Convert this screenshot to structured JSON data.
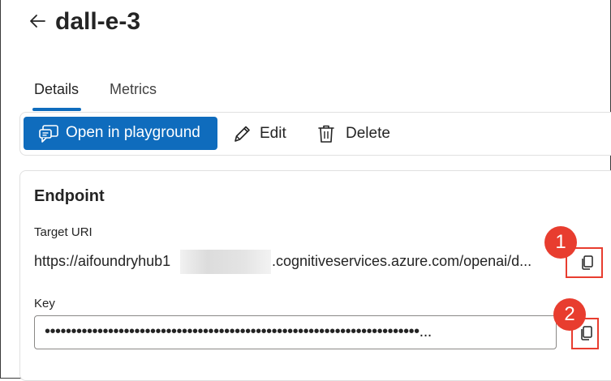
{
  "header": {
    "title": "dall-e-3",
    "back_icon": "arrow-left-icon"
  },
  "tabs": [
    {
      "label": "Details",
      "active": true
    },
    {
      "label": "Metrics",
      "active": false
    }
  ],
  "toolbar": {
    "open_playground_label": "Open in playground",
    "edit_label": "Edit",
    "delete_label": "Delete",
    "accent_color": "#0f6cbd"
  },
  "endpoint": {
    "title": "Endpoint",
    "target_uri_label": "Target URI",
    "target_uri_prefix": "https://aifoundryhub1",
    "target_uri_suffix": ".cognitiveservices.azure.com/openai/d...",
    "key_label": "Key",
    "key_value": "•••••••••••••••••••••••••••••••••••••••••••••••••••••••••••••••••••••••...",
    "copy_icon": "copy-icon"
  },
  "annotations": {
    "badge_1": "1",
    "badge_2": "2",
    "highlight_color": "#e83d2f"
  }
}
